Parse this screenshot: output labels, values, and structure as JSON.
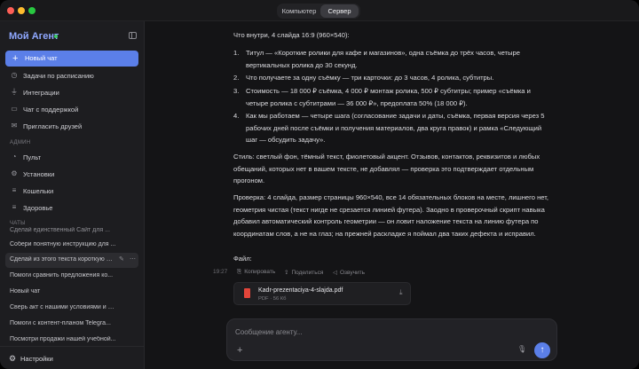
{
  "window": {
    "tabs": [
      {
        "label": "Компьютер",
        "active": false
      },
      {
        "label": "Сервер",
        "active": true
      }
    ]
  },
  "sidebar": {
    "brand": "Мой Агент",
    "new_chat": "Новый чат",
    "nav": [
      {
        "label": "Задачи по расписанию",
        "icon": "clock-icon"
      },
      {
        "label": "Интеграции",
        "icon": "plug-icon"
      },
      {
        "label": "Чат с поддержкой",
        "icon": "chat-bubble-icon"
      },
      {
        "label": "Пригласить друзей",
        "icon": "gift-icon"
      }
    ],
    "admin_label": "АДМИН",
    "admin": [
      {
        "label": "Пульт",
        "icon": "gauge-icon"
      },
      {
        "label": "Установки",
        "icon": "sliders-icon"
      },
      {
        "label": "Кошельки",
        "icon": "list-icon"
      },
      {
        "label": "Здоровье",
        "icon": "list-icon"
      }
    ],
    "chats_label": "ЧАТЫ",
    "chats": [
      "Сделай единственный Сайт для ...",
      "Собери понятную инструкцию для ...",
      "Сделай из этого текста короткую п...",
      "Помоги сравнить предложения ко...",
      "Новый чат",
      "Сверь акт с нашими условиями и п...",
      "Помоги с контент-планом Telegra...",
      "Посмотри продажи нашей учебной..."
    ],
    "settings": "Настройки"
  },
  "message": {
    "intro": "Что внутри, 4 слайда 16:9 (960×540):",
    "items": [
      {
        "num": "1.",
        "text": "Титул — «Короткие ролики для кафе и магазинов», одна съёмка до трёх часов, четыре вертикальных ролика до 30 секунд."
      },
      {
        "num": "2.",
        "text": "Что получаете за одну съёмку — три карточки: до 3 часов, 4 ролика, субтитры."
      },
      {
        "num": "3.",
        "text": "Стоимость — 18 000 ₽ съёмка, 4 000 ₽ монтаж ролика, 500 ₽ субтитры; пример «съёмка и четыре ролика с субтитрами — 36 000 ₽», предоплата 50% (18 000 ₽)."
      },
      {
        "num": "4.",
        "text": "Как мы работаем — четыре шага (согласование задачи и даты, съёмка, первая версия через 5 рабочих дней после съёмки и получения материалов, два круга правок) и рамка «Следующий шаг — обсудить задачу»."
      }
    ],
    "style": "Стиль: светлый фон, тёмный текст, фиолетовый акцент. Отзывов, контактов, реквизитов и любых обещаний, которых нет в вашем тексте, не добавлял — проверка это подтверждает отдельным прогоном.",
    "check": "Проверка: 4 слайда, размер страницы 960×540, все 14 обязательных блоков на месте, лишнего нет, геометрия чистая (текст нигде не срезается линией футера). Заодно в проверочный скрипт навыка добавил автоматический контроль геометрии — он ловит наложение текста на линию футера по координатам слов, а не на глаз; на прежней раскладке я поймал два таких дефекта и исправил.",
    "file_label": "Файл:",
    "time": "19:27",
    "actions": {
      "copy": "Копировать",
      "share": "Поделиться",
      "speak": "Озвучить"
    },
    "file": {
      "name": "Kadr-prezentaciya-4-slajda.pdf",
      "meta": "PDF · 56 Кб"
    }
  },
  "composer": {
    "placeholder": "Сообщение агенту..."
  }
}
